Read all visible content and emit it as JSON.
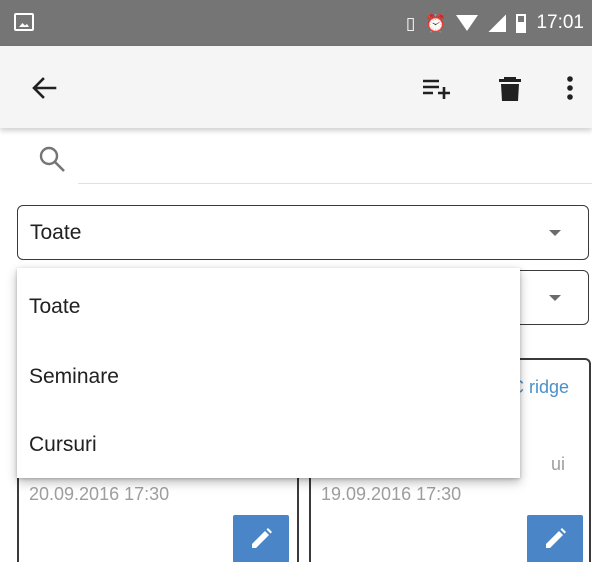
{
  "status_bar": {
    "time": "17:01",
    "icons": [
      "image-icon",
      "vibrate-icon",
      "alarm-icon",
      "wifi-icon",
      "signal-icon",
      "battery-icon"
    ]
  },
  "toolbar": {
    "icons": [
      "back-arrow-icon",
      "playlist-add-icon",
      "delete-icon",
      "more-vert-icon"
    ]
  },
  "search": {
    "placeholder": "",
    "value": ""
  },
  "filters": {
    "type_select_value": "Toate",
    "second_select_value": ""
  },
  "dropdown_menu": {
    "options": [
      "Toate",
      "Seminare",
      "Cursuri"
    ]
  },
  "cards": [
    {
      "date": "20.09.2016 17:30",
      "title_fragment": "",
      "subtitle_fragment": ""
    },
    {
      "date": "19.09.2016 17:30",
      "title_fragment": "IC ridge",
      "subtitle_fragment": "ui"
    }
  ],
  "colors": {
    "status_bar": "#757575",
    "toolbar": "#f5f5f5",
    "accent_blue": "#4a86c7",
    "link_blue": "#4a90c9"
  }
}
